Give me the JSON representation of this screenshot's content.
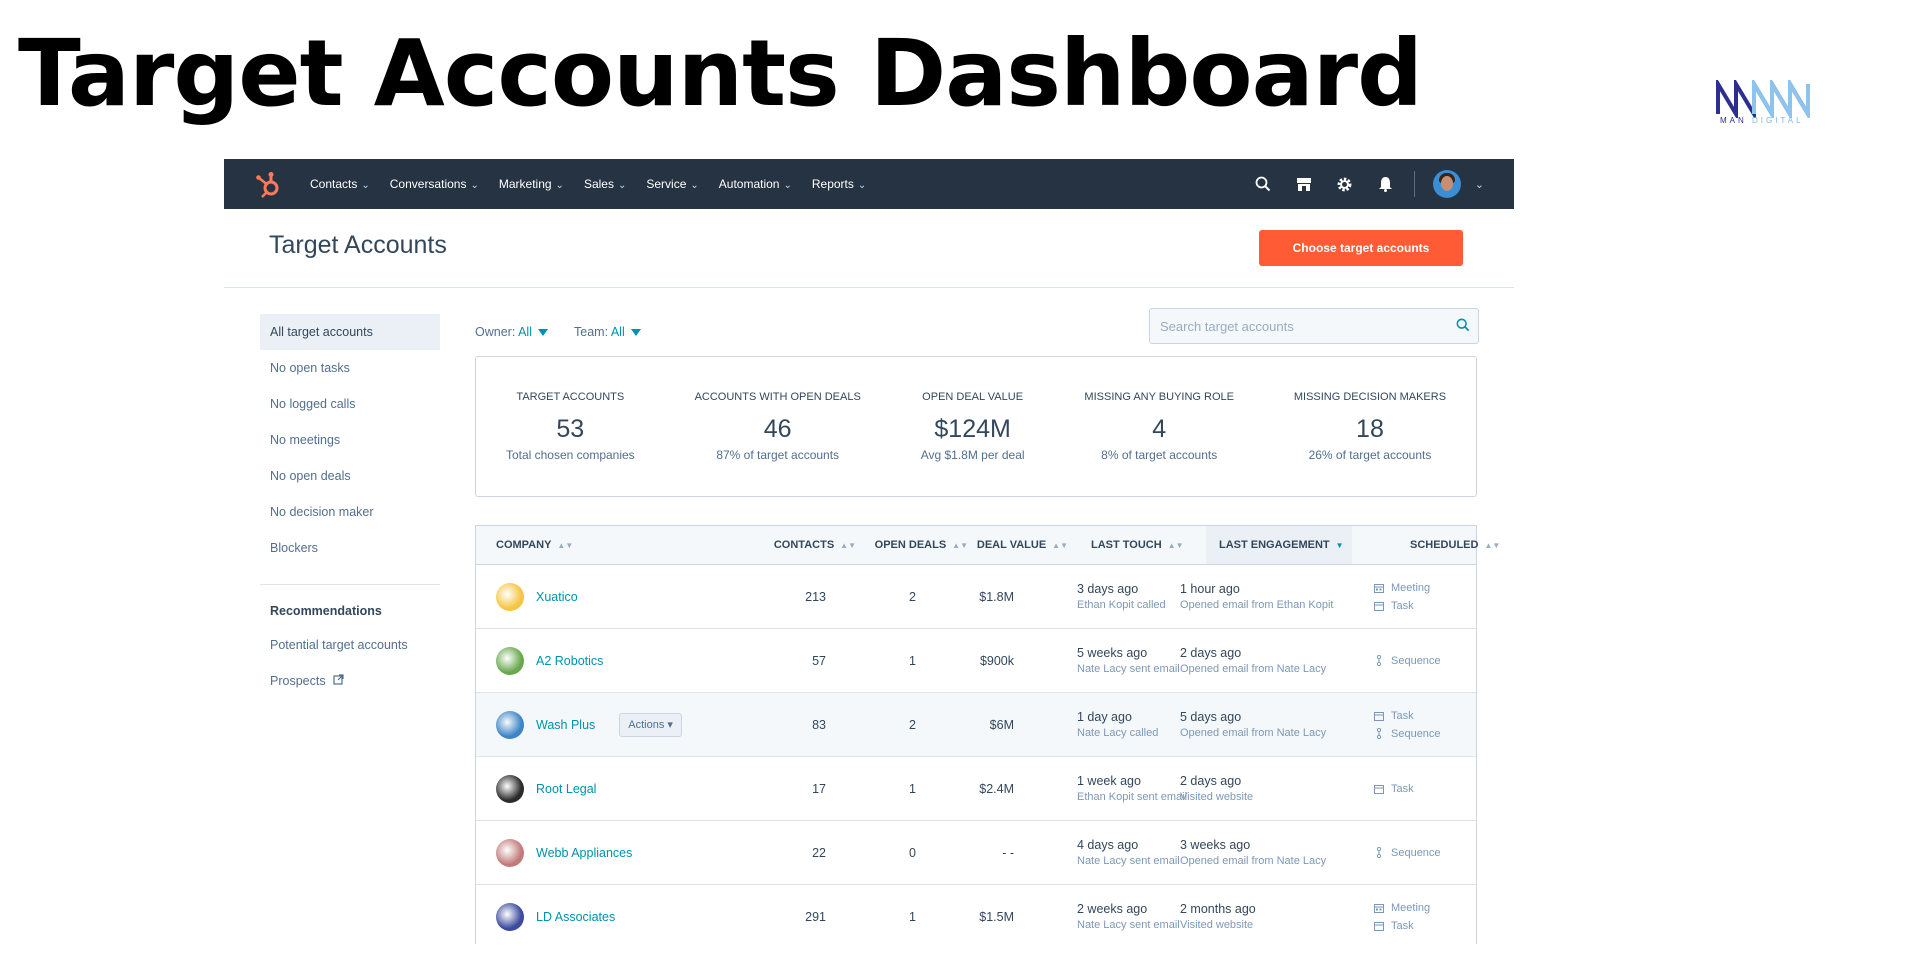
{
  "slide": {
    "title": "Target Accounts Dashboard",
    "logo_text_main": "MAN",
    "logo_text_sub": "DIGITAL"
  },
  "nav": {
    "items": [
      {
        "label": "Contacts"
      },
      {
        "label": "Conversations"
      },
      {
        "label": "Marketing"
      },
      {
        "label": "Sales"
      },
      {
        "label": "Service"
      },
      {
        "label": "Automation"
      },
      {
        "label": "Reports"
      }
    ],
    "icons": [
      "search-icon",
      "marketplace-icon",
      "settings-icon",
      "notifications-icon"
    ]
  },
  "page": {
    "title": "Target Accounts",
    "primary_button": "Choose target accounts"
  },
  "sidebar": {
    "items": [
      {
        "label": "All target accounts",
        "active": true
      },
      {
        "label": "No open tasks"
      },
      {
        "label": "No logged calls"
      },
      {
        "label": "No meetings"
      },
      {
        "label": "No open deals"
      },
      {
        "label": "No decision maker"
      },
      {
        "label": "Blockers"
      }
    ],
    "recommendations_heading": "Recommendations",
    "recommendations": [
      {
        "label": "Potential target accounts"
      },
      {
        "label": "Prospects"
      }
    ]
  },
  "filters": {
    "owner_label": "Owner:",
    "owner_value": "All",
    "team_label": "Team:",
    "team_value": "All"
  },
  "search": {
    "placeholder": "Search target accounts"
  },
  "stats": [
    {
      "label": "TARGET ACCOUNTS",
      "value": "53",
      "sub": "Total chosen companies"
    },
    {
      "label": "ACCOUNTS WITH OPEN DEALS",
      "value": "46",
      "sub": "87% of target accounts"
    },
    {
      "label": "OPEN DEAL VALUE",
      "value": "$124M",
      "sub": "Avg $1.8M per deal"
    },
    {
      "label": "MISSING ANY BUYING ROLE",
      "value": "4",
      "sub": "8% of target accounts"
    },
    {
      "label": "MISSING DECISION MAKERS",
      "value": "18",
      "sub": "26% of target accounts"
    }
  ],
  "table": {
    "headers": {
      "company": "COMPANY",
      "contacts": "CONTACTS",
      "open_deals": "OPEN DEALS",
      "deal_value": "DEAL VALUE",
      "last_touch": "LAST TOUCH",
      "last_engagement": "LAST ENGAGEMENT",
      "scheduled": "SCHEDULED"
    },
    "actions_label": "Actions",
    "rows": [
      {
        "company": "Xuatico",
        "logo_color": "#f5c542",
        "contacts": "213",
        "open_deals": "2",
        "deal_value": "$1.8M",
        "touch": "3 days ago",
        "touch_sub": "Ethan Kopit called",
        "eng": "1 hour ago",
        "eng_sub": "Opened email from Ethan Kopit",
        "sched": [
          "Meeting",
          "Task"
        ]
      },
      {
        "company": "A2 Robotics",
        "logo_color": "#6aa84f",
        "contacts": "57",
        "open_deals": "1",
        "deal_value": "$900k",
        "touch": "5 weeks ago",
        "touch_sub": "Nate Lacy sent email",
        "eng": "2 days ago",
        "eng_sub": "Opened email from Nate Lacy",
        "sched": [
          "Sequence"
        ]
      },
      {
        "company": "Wash Plus",
        "logo_color": "#3d85c6",
        "contacts": "83",
        "open_deals": "2",
        "deal_value": "$6M",
        "touch": "1 day ago",
        "touch_sub": "Nate Lacy called",
        "eng": "5 days ago",
        "eng_sub": "Opened email from Nate Lacy",
        "sched": [
          "Task",
          "Sequence"
        ]
      },
      {
        "company": "Root Legal",
        "logo_color": "#2b2b2b",
        "contacts": "17",
        "open_deals": "1",
        "deal_value": "$2.4M",
        "touch": "1 week ago",
        "touch_sub": "Ethan Kopit sent email",
        "eng": "2 days ago",
        "eng_sub": "Visited website",
        "sched": [
          "Task"
        ]
      },
      {
        "company": "Webb Appliances",
        "logo_color": "#c27b7b",
        "contacts": "22",
        "open_deals": "0",
        "deal_value": "- -",
        "touch": "4 days ago",
        "touch_sub": "Nate Lacy sent email",
        "eng": "3 weeks ago",
        "eng_sub": "Opened email from Nate Lacy",
        "sched": [
          "Sequence"
        ]
      },
      {
        "company": "LD Associates",
        "logo_color": "#3b4a9e",
        "contacts": "291",
        "open_deals": "1",
        "deal_value": "$1.5M",
        "touch": "2 weeks ago",
        "touch_sub": "Nate Lacy sent email",
        "eng": "2 months ago",
        "eng_sub": "Visited website",
        "sched": [
          "Meeting",
          "Task"
        ]
      }
    ]
  },
  "colors": {
    "nav_bg": "#253342",
    "accent": "#ff5c35",
    "link": "#0091ae"
  }
}
